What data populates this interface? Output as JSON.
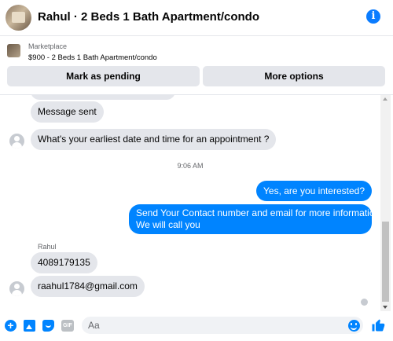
{
  "header": {
    "title": "Rahul · 2 Beds 1 Bath Apartment/condo",
    "info_icon": "info-icon"
  },
  "marketplace": {
    "label": "Marketplace",
    "item": "$900 - 2 Beds 1 Bath Apartment/condo",
    "buttons": {
      "pending": "Mark as pending",
      "more": "More options"
    }
  },
  "messages": {
    "message_sent": "Message sent",
    "question": "What's your earliest date and time for an appointment ?",
    "timestamp": "9:06 AM",
    "reply_1": "Yes, are you interested?",
    "reply_2_line_1": "Send Your Contact number and email for more information",
    "reply_2_line_2": "We will call you",
    "sender_name": "Rahul",
    "phone": "4089179135",
    "email": "raahul1784@gmail.com"
  },
  "composer": {
    "placeholder": "Aa",
    "gif_label": "GIF",
    "icons": [
      "plus-icon",
      "photo-icon",
      "sticker-icon",
      "gif-icon",
      "emoji-icon",
      "like-icon"
    ]
  },
  "colors": {
    "accent": "#0084ff",
    "bubble_incoming": "#e4e6eb",
    "button_bg": "#e4e6eb"
  }
}
